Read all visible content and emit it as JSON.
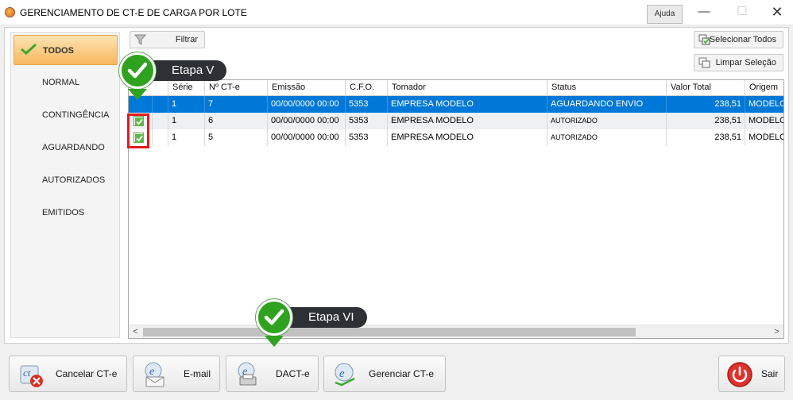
{
  "window": {
    "title": "GERENCIAMENTO DE CT-E DE CARGA POR LOTE",
    "help_label": "Ajuda",
    "minimize_glyph": "—",
    "maximize_glyph": "☐",
    "close_glyph": "✕"
  },
  "menu": {
    "items": [
      {
        "label": "TODOS",
        "active": true
      },
      {
        "label": "NORMAL"
      },
      {
        "label": "CONTINGÊNCIA"
      },
      {
        "label": "AGUARDANDO"
      },
      {
        "label": "AUTORIZADOS"
      },
      {
        "label": "EMITIDOS"
      }
    ]
  },
  "toolbar": {
    "filter_label": "Filtrar",
    "select_all_label": "Selecionar Todos",
    "clear_selection_label": "Limpar Seleção"
  },
  "grid": {
    "columns": [
      "Série",
      "Nº CT-e",
      "Emissão",
      "C.F.O.",
      "Tomador",
      "Status",
      "Valor Total",
      "Origem"
    ],
    "rows": [
      {
        "checked": false,
        "selected": true,
        "serie": "1",
        "numero": "7",
        "emissao": "00/00/0000 00:00",
        "cfo": "5353",
        "tomador": "EMPRESA MODELO",
        "status": "AGUARDANDO ENVIO",
        "valor": "238,51",
        "origem": "MODELO"
      },
      {
        "checked": true,
        "selected": false,
        "serie": "1",
        "numero": "6",
        "emissao": "00/00/0000 00:00",
        "cfo": "5353",
        "tomador": "EMPRESA MODELO",
        "status": "AUTORIZADO",
        "valor": "238,51",
        "origem": "MODELO"
      },
      {
        "checked": true,
        "selected": false,
        "serie": "1",
        "numero": "5",
        "emissao": "00/00/0000 00:00",
        "cfo": "5353",
        "tomador": "EMPRESA MODELO",
        "status": "AUTORIZADO",
        "valor": "238,51",
        "origem": "MODELO"
      }
    ],
    "scroll_left": "<",
    "scroll_right": ">"
  },
  "callouts": {
    "step5": "Etapa V",
    "step6": "Etapa VI"
  },
  "bottom": {
    "cancel_label": "Cancelar CT-e",
    "email_label": "E-mail",
    "dacte_label": "DACT-e",
    "manage_label": "Gerenciar CT-e",
    "exit_label": "Sair"
  },
  "colors": {
    "selection": "#0078d7",
    "active_menu": "#f7b85e",
    "callout_badge": "#2fa21f",
    "callout_pill": "#2d3035",
    "highlight_box": "#e41b1b"
  }
}
